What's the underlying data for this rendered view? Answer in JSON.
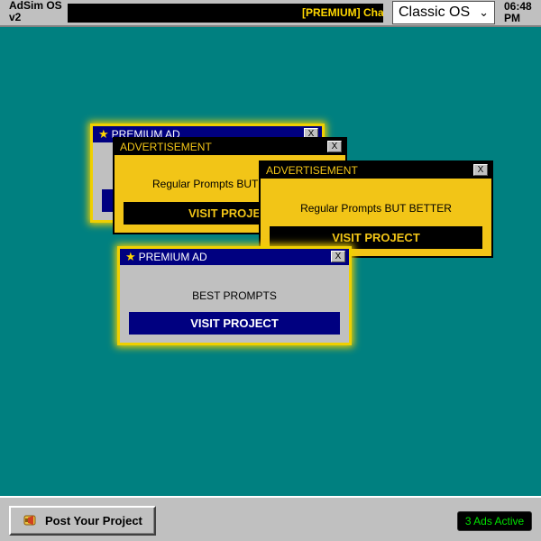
{
  "app": {
    "title": "AdSim OS v2"
  },
  "ticker": {
    "text": "[PREMIUM] Chap"
  },
  "theme_select": {
    "selected": "Classic OS"
  },
  "clock": {
    "time": "06:48 PM"
  },
  "windows": [
    {
      "kind": "premium",
      "title": "PREMIUM AD",
      "close": "X",
      "message": "",
      "button": ""
    },
    {
      "kind": "advert",
      "title": "ADVERTISEMENT",
      "close": "X",
      "message": "Regular Prompts BUT",
      "button": "VISIT PROJEC"
    },
    {
      "kind": "advert",
      "title": "ADVERTISEMENT",
      "close": "X",
      "message": "Regular Prompts BUT BETTER",
      "button": "VISIT PROJECT"
    },
    {
      "kind": "premium",
      "title": "PREMIUM AD",
      "close": "X",
      "message": "BEST PROMPTS",
      "button": "VISIT PROJECT"
    }
  ],
  "taskbar": {
    "post_button": "Post Your Project",
    "ads_active": "3 Ads Active"
  },
  "colors": {
    "desktop": "#008080",
    "premium_title": "#000080",
    "advert_body": "#f2c517",
    "premium_glow": "#f0d000",
    "status_text": "#00e000"
  },
  "icons": {
    "star": "star-icon",
    "megaphone": "megaphone-icon",
    "chevron": "chevron-down-icon"
  }
}
